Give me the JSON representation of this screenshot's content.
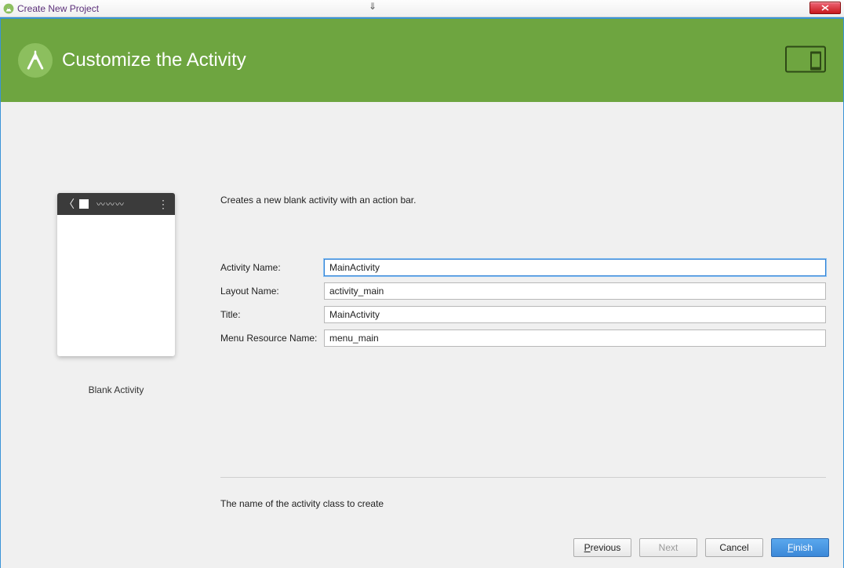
{
  "window": {
    "title": "Create New Project"
  },
  "banner": {
    "title": "Customize the Activity"
  },
  "preview": {
    "label": "Blank Activity"
  },
  "form": {
    "description": "Creates a new blank activity with an action bar.",
    "activity_name": {
      "label": "Activity Name:",
      "value": "MainActivity"
    },
    "layout_name": {
      "label": "Layout Name:",
      "value": "activity_main"
    },
    "title": {
      "label": "Title:",
      "value": "MainActivity"
    },
    "menu_resource": {
      "label": "Menu Resource Name:",
      "value": "menu_main"
    },
    "help_text": "The name of the activity class to create"
  },
  "buttons": {
    "previous": "Previous",
    "next": "Next",
    "cancel": "Cancel",
    "finish": "Finish"
  }
}
